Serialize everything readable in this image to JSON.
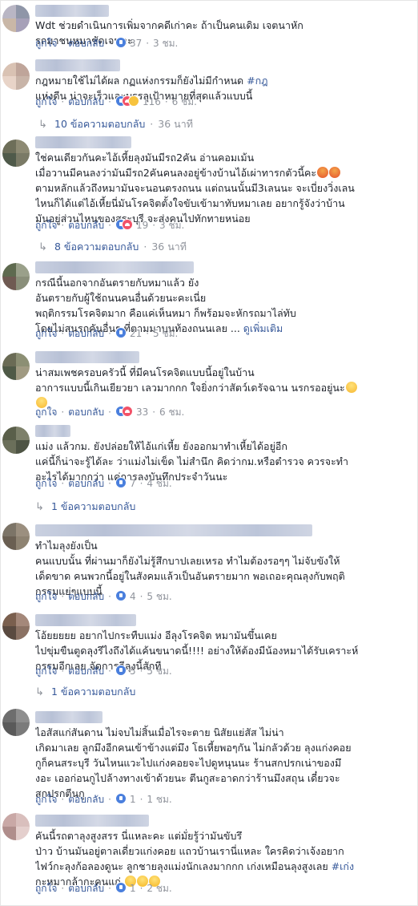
{
  "actions": {
    "like": "ถูกใจ",
    "reply": "ตอบกลับ",
    "dot": "·"
  },
  "colors": {
    "link": "#365899",
    "meta": "#90949c",
    "text": "#1d2129",
    "like_reaction": "#4a7fdd",
    "love_reaction": "#f25268",
    "haha_reaction": "#f7c33e"
  },
  "comments": [
    {
      "lines": [
        "Wdt ช่วยดำเนินการเพิ่มจากคดีเก่าคะ ถ้าเป็นคนเดิม เจตนาหัก",
        "รถมาชนหมาชัดเจนคะ"
      ],
      "count": "37",
      "time": "3 ชม.",
      "reactions": [
        "like"
      ]
    },
    {
      "lines": [
        "กฎหมายใช้ไม่ได้ผล กฏแห่งกรรมก็ยังไม่มีกำหนด ",
        "แห่งดีน น่าจะเร็วและบรรลุเป้าหมายที่สุดแล้วแบบนี้"
      ],
      "hashtag": "#กฎ",
      "count": "116",
      "time": "6 ชม.",
      "reactions": [
        "like",
        "love",
        "haha"
      ]
    },
    {
      "lines": [
        "ใช่คนเดียวกันคะไอ้เหี้ยลุงมันมีรถ2คัน อ่านคอมเม้น",
        "เมื่อวานมีคนลงว่ามันมีรถ2คันคนลงอยู่ข้างบ้านไอ้เผ่าทารกตัวนี้คะ",
        "ตามหลักแล้วถึงหมามันจะนอนตรงถนน แต่ถนนนั้นมี3เลนนะ จะเบี่ยงวิ่งเลน",
        "ไหนก็ได้แต่ไอ้เหี้ยนี่มันโรคจิตตั้งใจขับเข้ามาทับหมาเลย อยากรู้จังว่าบ้าน",
        "มันอยู่ส่วนไหนของสระบุรี จะส่งคนไปทักทายหน่อย"
      ],
      "count": "19",
      "time": "3 ชม.",
      "reactions": [
        "like",
        "love"
      ]
    },
    {
      "lines": [
        "กรณีนี้นอกจากอันตรายกับหมาแล้ว ยัง",
        "อันตรายกับผู้ใช้ถนนคนอื่นด้วยนะคะเนี่ย",
        "พฤติกรรมโรคจิตมาก คือแค่เห็นหมา ก็พร้อมจะหักรถมาไล่ทับ",
        "โดยไม่สนรถคันอื่นๆ ที่ตามมาบนท้องถนนเลย ... "
      ],
      "see_more": "ดูเพิ่มเติม",
      "count": "21",
      "time": "5 ชม.",
      "reactions": [
        "like"
      ]
    },
    {
      "lines": [
        "น่าสมเพชครอบครัวนี้ ที่มีคนโรคจิตแบบนี้อยู่ในบ้าน",
        "อาการแบบนี้เกินเยียวยา เลวมากกก ใจยิ่งกว่าสัตว์เดรัจฉาน นรกรออยู่นะ",
        ""
      ],
      "count": "33",
      "time": "6 ชม.",
      "reactions": [
        "like",
        "love"
      ]
    },
    {
      "lines": [
        "แม่ง แล้วกม. ยังปล่อยให้ไอ้แก่เหี้ย ยังออกมาทำเหี้ยได้อยู่อีก",
        "แค่นี้ก็น่าจะรู้ได้ละ ว่าแม่งไม่เข็ด ไม่สำนึก คิดว่ากม.หรือตำรวจ ควรจะทำ",
        "อะไรได้มากกว่า แค่การลงบันทึกประจำวันนะ"
      ],
      "count": "7",
      "time": "4 ชม.",
      "reactions": [
        "like"
      ]
    },
    {
      "lines": [
        "ทำไมลุงยังเป็น",
        "คนแบบนั้น ที่ผ่านมาก็ยังไม่รู้สึกบาปเลยเหรอ ทำไมต้องรอๆๆ ไม่จับขังให้",
        "เด็ดขาด คนพวกนี้อยู่ในสังคมแล้วเป็นอันตรายมาก พอเถอะคุณลุงกับพฤติ",
        "กรรมแย่ๆแบบนี้"
      ],
      "count": "4",
      "time": "5 ชม.",
      "reactions": [
        "like"
      ]
    },
    {
      "lines": [
        "โอ้ยยยยย อยากไปกระทืบแม่ง อีลุงโรคจิต หมามันขึ้นเคย",
        "ไปขุ่มขืนตูดลุงรึไงถึงได้แค้นขนาดนี้!!!! อย่างให้ต้องมีน้องหมาได้รับเคราะห์",
        "กรรมอีกเลย จัดการอีลุงนี้สักที"
      ],
      "count": "5",
      "time": "5 ชม.",
      "reactions": [
        "like"
      ]
    },
    {
      "lines": [
        "ไอสัสแก่สันดาน ไม่จบไม่สิ้นเมื่อไรจะตาย นิสัยแย่สัส ไม่น่า",
        "เกิดมาเลย ลูกมึงอีกคนเข้าข้างแต่มึง โธเหี้ยพอๆกัน ไม่กลัวด้วย ลุงแก่งคอย",
        "กูก็คนสระบุรี วันไหนแวะไปแก่งคอยจะไปดูหนุนนะ ร้านสกปรกเน่าของมึ",
        "งอะ เออก่อนกูไปล้างทางเข้าด้วยนะ ตีนกูสะอาดกว่าร้านมึงสถุน เดี๋ยวจะ",
        "สกปรกตีนกู"
      ],
      "count": "1",
      "time": "1 ชม.",
      "reactions": [
        "like"
      ]
    },
    {
      "lines": [
        "คันนี้รถตาลุงสูงสรร นี่แหละคะ แต่มั่ยรู้ว่ามันขับรึ",
        "ป่าว บ้านมันอยู่ตาลเดี่ยวแก่งคอย แถวบ้านเรานี่แหละ ใครคิดว่าเจ้งอยาก",
        "ไฟว์กะลุงก้อลองดูนะ ลูกชายลุงแม่งนักเลงมากกก เก่งเหมือนลุงสูงเลย ",
        "กะหมากล้ากะคนแก่ "
      ],
      "hashtag": "#เก่ง",
      "count": "1",
      "time": "2 ชม.",
      "reactions": [
        "like"
      ]
    }
  ],
  "replies": [
    {
      "label": "10 ข้อความตอบกลับ",
      "time": "36 นาที"
    },
    {
      "label": "8 ข้อความตอบกลับ",
      "time": "36 นาที"
    },
    {
      "label": "1 ข้อความตอบกลับ",
      "time": ""
    },
    {
      "label": "1 ข้อความตอบกลับ",
      "time": ""
    }
  ]
}
